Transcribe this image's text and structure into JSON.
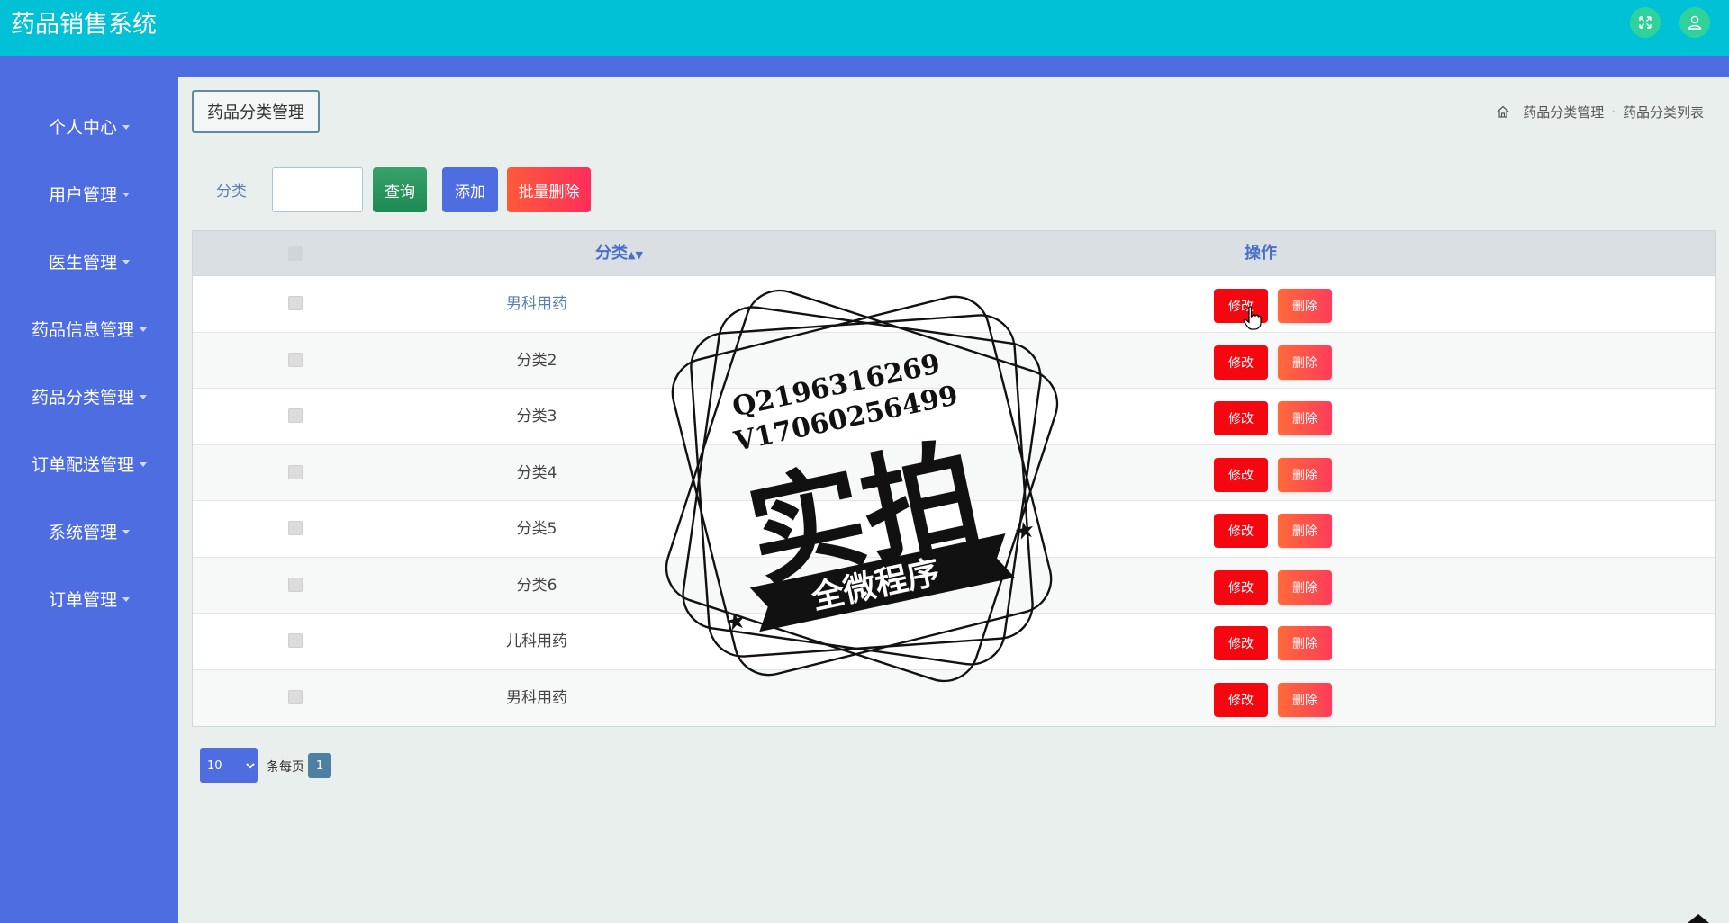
{
  "header": {
    "app_title": "药品销售系统",
    "fullscreen_icon": "fullscreen-icon",
    "user_icon": "user-icon"
  },
  "sidebar": {
    "items": [
      {
        "label": "个人中心"
      },
      {
        "label": "用户管理"
      },
      {
        "label": "医生管理"
      },
      {
        "label": "药品信息管理"
      },
      {
        "label": "药品分类管理"
      },
      {
        "label": "订单配送管理"
      },
      {
        "label": "系统管理"
      },
      {
        "label": "订单管理"
      }
    ]
  },
  "main": {
    "page_title": "药品分类管理",
    "breadcrumb": [
      "药品分类管理",
      "药品分类列表"
    ],
    "search": {
      "label": "分类",
      "value": "",
      "placeholder": ""
    },
    "buttons": {
      "query": "查询",
      "add": "添加",
      "batch_delete": "批量删除"
    },
    "table": {
      "columns": [
        "分类",
        "操作"
      ],
      "sort_icon": "sort-icon",
      "rows": [
        {
          "name": "男科用药"
        },
        {
          "name": "分类2"
        },
        {
          "name": "分类3"
        },
        {
          "name": "分类4"
        },
        {
          "name": "分类5"
        },
        {
          "name": "分类6"
        },
        {
          "name": "儿科用药"
        },
        {
          "name": "男科用药"
        }
      ],
      "edit_label": "修改",
      "delete_label": "删除"
    },
    "pagination": {
      "page_size": "10",
      "per_page_label": "条每页",
      "current_page": "1"
    }
  },
  "watermark": {
    "line1": "Q2196316269",
    "line2": "V17060256499",
    "big_text": "实拍",
    "ribbon_text": "全微程序"
  },
  "colors": {
    "header": "#00c1d6",
    "sidebar": "#4e6de1",
    "edit_button": "#f4070f",
    "delete_button": "#ff4a4a",
    "query_button": "#2a9660"
  }
}
